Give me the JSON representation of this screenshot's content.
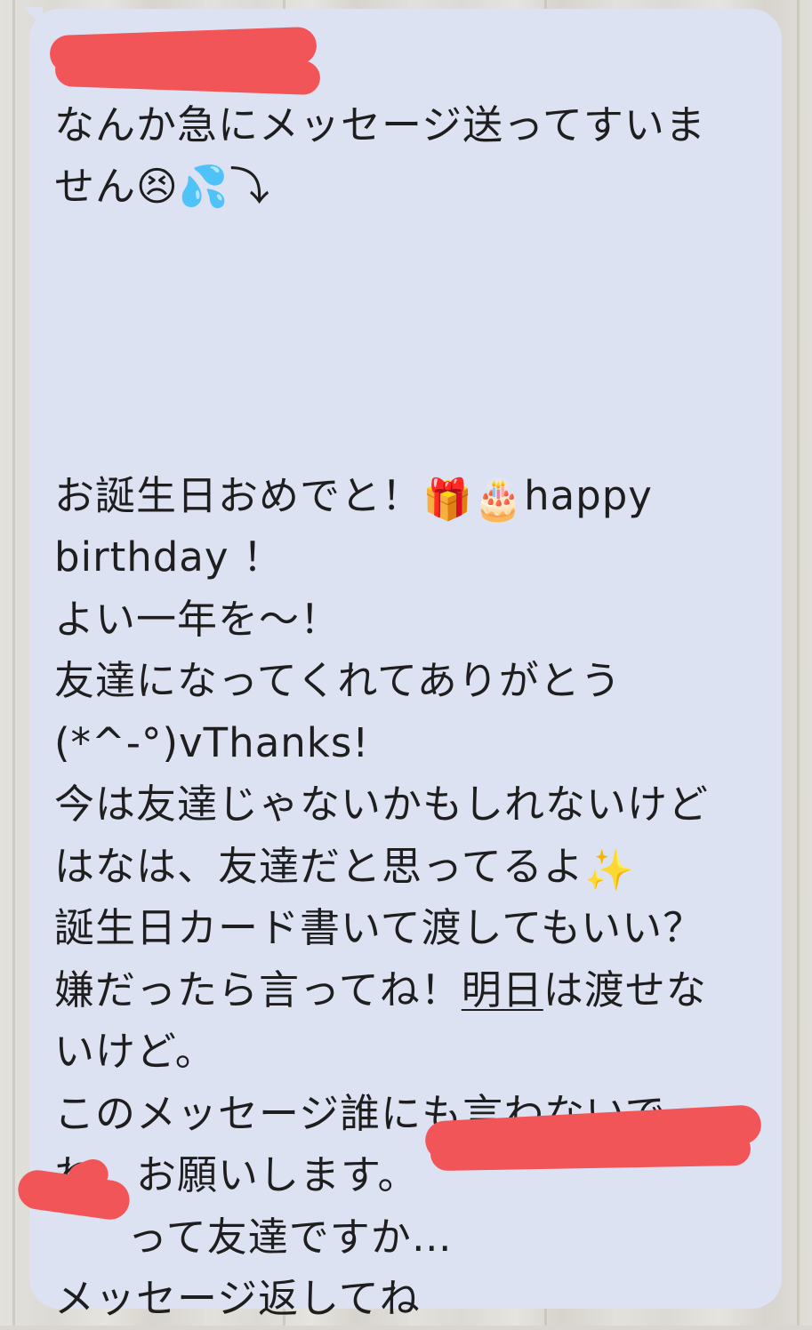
{
  "message": {
    "greeting_line": "",
    "lines": [
      "なんか急にメッセージ送ってすいま",
      "せん😣💦⤵"
    ],
    "birthday_line_1_prefix": "お誕生日おめでと！",
    "birthday_line_1_emoji": "🎁🎂",
    "birthday_line_1_suffix": "happy",
    "birthday_line_2": "birthday ！",
    "line_year": "よい一年を〜！",
    "line_friends": "友達になってくれてありがとう",
    "line_thanks": "(*^-°)vThanks!",
    "line_now": "今は友達じゃないかもしれないけど",
    "line_hanaha_text": "はなは、友達だと思ってるよ",
    "line_hanaha_emoji": "✨",
    "line_card": "誕生日カード書いて渡してもいい？",
    "line_dislike_prefix": "嫌だったら言ってね！",
    "line_dislike_link": "明日",
    "line_dislike_suffix": "は渡せな",
    "line_but": "いけど。",
    "line_secret_1": "このメッセージ誰にも言わないで",
    "line_secret_2": "ね。お願いします。",
    "line_friend_q": "って友達ですか…",
    "line_reply": "メッセージ返してね"
  },
  "colors": {
    "bubble": "#dde2f3",
    "text": "#1e1e1e",
    "redaction": "#f15558",
    "background": "#e1dfda"
  }
}
